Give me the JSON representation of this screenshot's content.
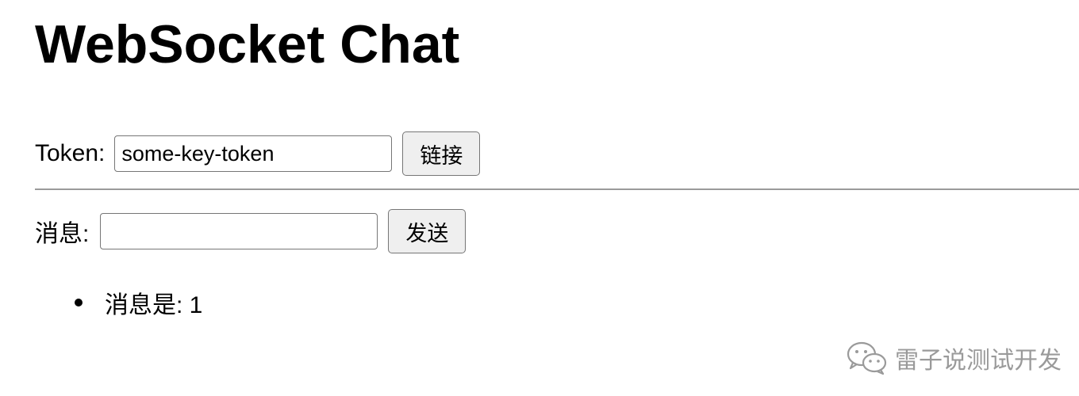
{
  "page": {
    "title": "WebSocket Chat"
  },
  "token_row": {
    "label": "Token:",
    "input_value": "some-key-token",
    "button_label": "链接"
  },
  "message_row": {
    "label": "消息:",
    "input_value": "",
    "button_label": "发送"
  },
  "messages": [
    {
      "text": "消息是: 1"
    }
  ],
  "watermark": {
    "text": "雷子说测试开发",
    "icon": "wechat-icon",
    "color": "#9a9a9a"
  }
}
